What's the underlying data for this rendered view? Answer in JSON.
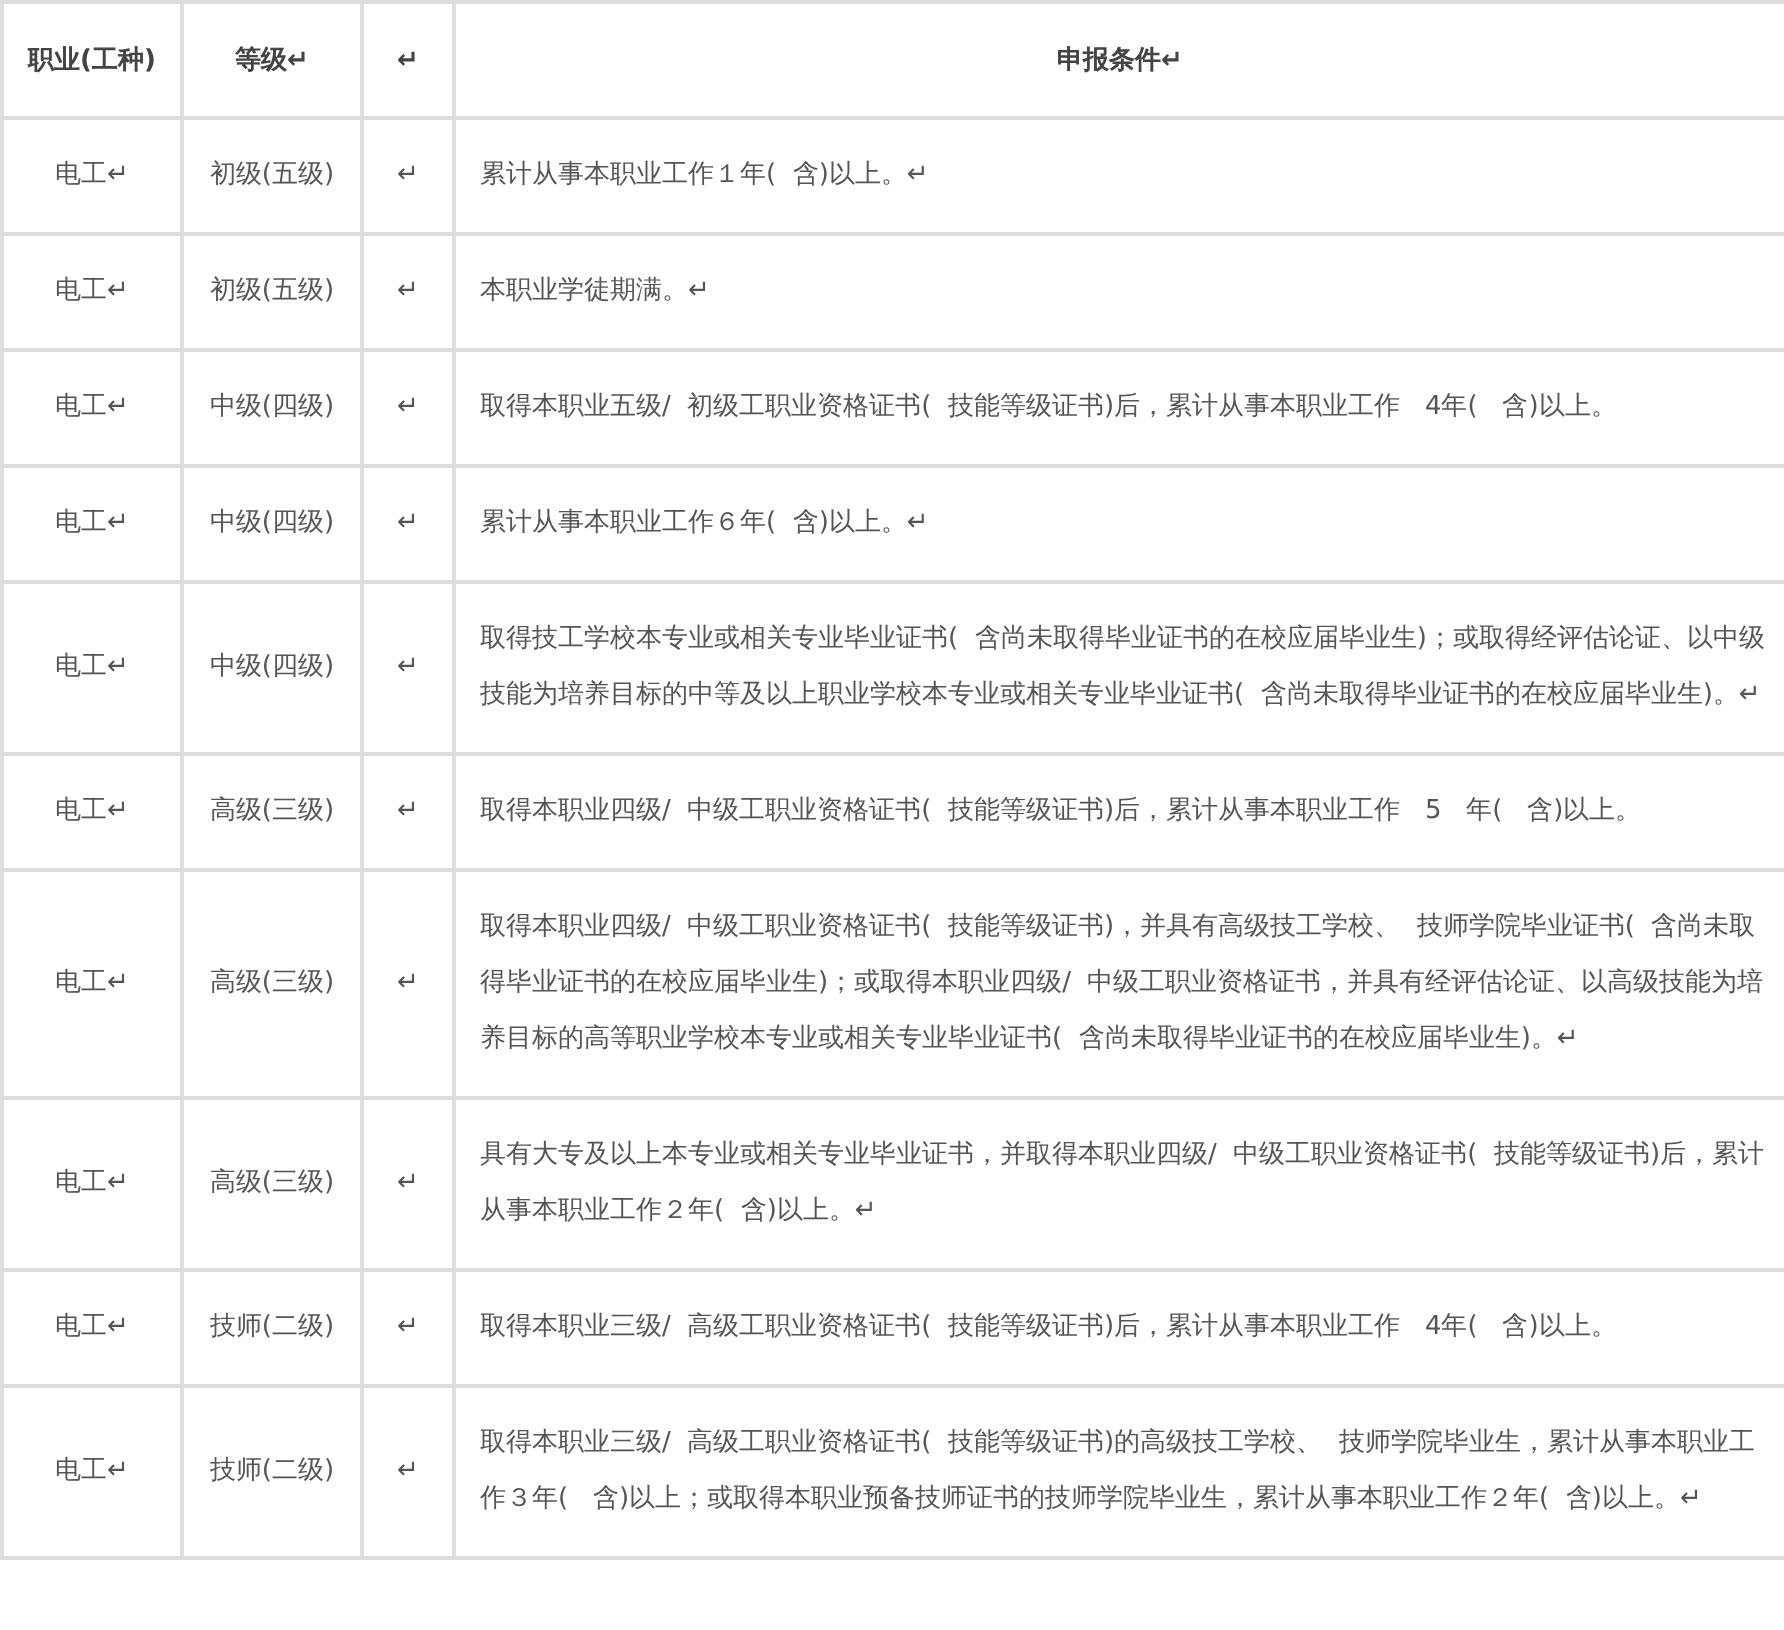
{
  "table": {
    "columns": [
      "职业(工种)",
      "等级↵",
      "↵",
      "申报条件↵"
    ],
    "rows": [
      {
        "occupation": "电工↵",
        "grade": "初级(五级)",
        "column_3": "↵",
        "conditions": "累计从事本职业工作１年(  含)以上。↵"
      },
      {
        "occupation": "电工↵",
        "grade": "初级(五级)",
        "column_3": "↵",
        "conditions": "本职业学徒期满。↵"
      },
      {
        "occupation": "电工↵",
        "grade": "中级(四级)",
        "column_3": "↵",
        "conditions": "取得本职业五级/  初级工职业资格证书(  技能等级证书)后，累计从事本职业工作   4年(   含)以上。"
      },
      {
        "occupation": "电工↵",
        "grade": "中级(四级)",
        "column_3": "↵",
        "conditions": "累计从事本职业工作６年(  含)以上。↵"
      },
      {
        "occupation": "电工↵",
        "grade": "中级(四级)",
        "column_3": "↵",
        "conditions": "取得技工学校本专业或相关专业毕业证书(  含尚未取得毕业证书的在校应届毕业生)；或取得经评估论证、以中级技能为培养目标的中等及以上职业学校本专业或相关专业毕业证书(  含尚未取得毕业证书的在校应届毕业生)。↵"
      },
      {
        "occupation": "电工↵",
        "grade": "高级(三级)",
        "column_3": "↵",
        "conditions": "取得本职业四级/  中级工职业资格证书(  技能等级证书)后，累计从事本职业工作   5   年(   含)以上。"
      },
      {
        "occupation": "电工↵",
        "grade": "高级(三级)",
        "column_3": "↵",
        "conditions": "取得本职业四级/  中级工职业资格证书(  技能等级证书)，并具有高级技工学校、  技师学院毕业证书(  含尚未取得毕业证书的在校应届毕业生)；或取得本职业四级/  中级工职业资格证书，并具有经评估论证、以高级技能为培养目标的高等职业学校本专业或相关专业毕业证书(  含尚未取得毕业证书的在校应届毕业生)。↵"
      },
      {
        "occupation": "电工↵",
        "grade": "高级(三级)",
        "column_3": "↵",
        "conditions": "具有大专及以上本专业或相关专业毕业证书，并取得本职业四级/  中级工职业资格证书(  技能等级证书)后，累计从事本职业工作２年(  含)以上。↵"
      },
      {
        "occupation": "电工↵",
        "grade": "技师(二级)",
        "column_3": "↵",
        "conditions": "取得本职业三级/  高级工职业资格证书(  技能等级证书)后，累计从事本职业工作   4年(   含)以上。"
      },
      {
        "occupation": "电工↵",
        "grade": "技师(二级)",
        "column_3": "↵",
        "conditions": "取得本职业三级/  高级工职业资格证书(  技能等级证书)的高级技工学校、  技师学院毕业生，累计从事本职业工作３年(   含)以上；或取得本职业预备技师证书的技师学院毕业生，累计从事本职业工作２年(  含)以上。↵"
      }
    ]
  }
}
